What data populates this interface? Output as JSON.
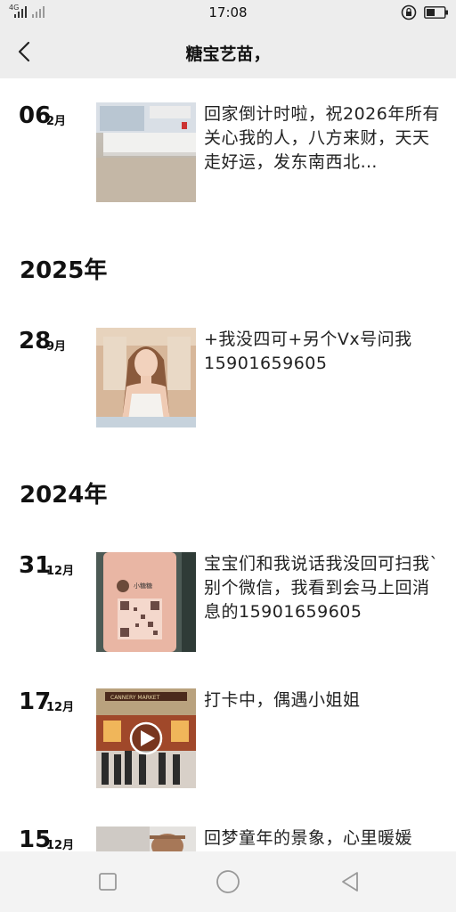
{
  "status_bar": {
    "network": "4G",
    "time": "17:08",
    "icons": [
      "signal-icon",
      "lock-rotation-icon",
      "battery-icon"
    ]
  },
  "header": {
    "title": "糖宝艺苗，",
    "back_icon": "back-arrow-icon"
  },
  "timeline": {
    "years": [
      "2025年",
      "2024年"
    ],
    "posts": [
      {
        "day": "06",
        "month": "2月",
        "text": "回家倒计时啦，祝2026年所有关心我的人，八方来财，天天走好运，发东南西北…"
      },
      {
        "day": "28",
        "month": "9月",
        "text": "+我没四可+另个Vx号问我15901659605"
      },
      {
        "day": "31",
        "month": "12月",
        "text": "宝宝们和我说话我没回可扫我`别个微信，我看到会马上回消息的15901659605",
        "image_caption": "小糖糖"
      },
      {
        "day": "17",
        "month": "12月",
        "text": "打卡中，偶遇小姐姐",
        "image_caption": "CANNERY MARKET"
      },
      {
        "day": "15",
        "month": "12月",
        "text": "回梦童年的景象，心里暖媛"
      }
    ]
  },
  "nav_bar": {
    "icons": [
      "recent-apps-icon",
      "home-icon",
      "back-icon"
    ]
  },
  "colors": {
    "bar_background": "#ededed",
    "text": "#111111"
  }
}
